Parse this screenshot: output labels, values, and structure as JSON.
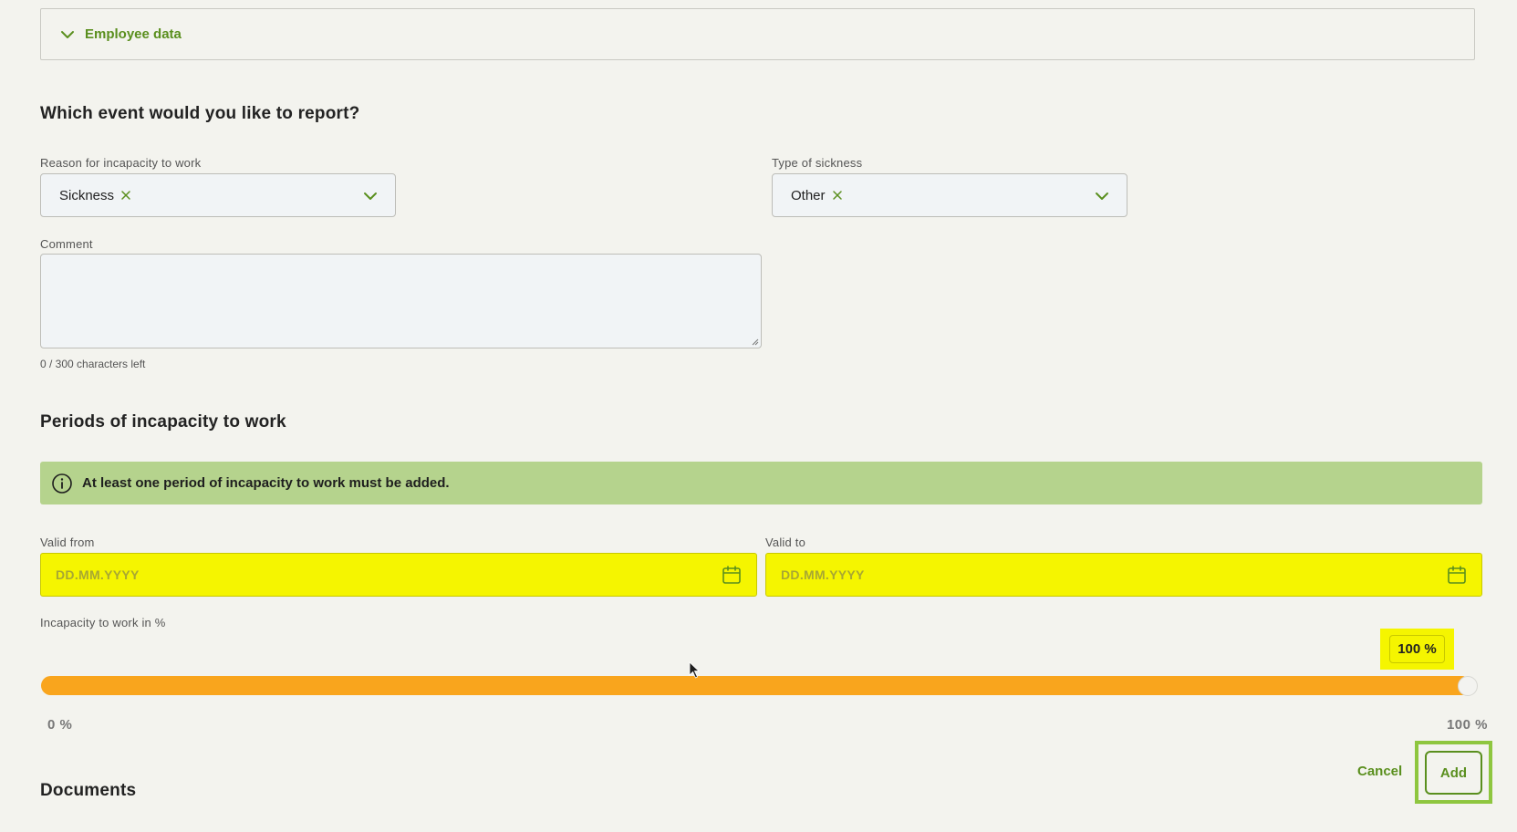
{
  "accordion": {
    "label": "Employee data"
  },
  "event_section": {
    "title": "Which event would you like to report?"
  },
  "reason_field": {
    "label": "Reason for incapacity to work",
    "value": "Sickness"
  },
  "sickness_type_field": {
    "label": "Type of sickness",
    "value": "Other"
  },
  "comment_field": {
    "label": "Comment",
    "value": "",
    "char_count": "0 / 300 characters left"
  },
  "periods_section": {
    "title": "Periods of incapacity to work",
    "info_message": "At least one period of incapacity to work must be added."
  },
  "valid_from": {
    "label": "Valid from",
    "placeholder": "DD.MM.YYYY"
  },
  "valid_to": {
    "label": "Valid to",
    "placeholder": "DD.MM.YYYY"
  },
  "incapacity_slider": {
    "label": "Incapacity to work in %",
    "value_label": "100 %",
    "value_percent": 100,
    "min_label": "0 %",
    "max_label": "100 %"
  },
  "actions": {
    "cancel_label": "Cancel",
    "add_label": "Add"
  },
  "documents_section": {
    "title": "Documents"
  },
  "colors": {
    "accent": "#5a8f1e",
    "info_bg": "#b5d38d",
    "highlight": "#f5f500",
    "slider_fill": "#f9a51d",
    "focus_outline": "#8ec63f"
  },
  "icons": [
    "chevron-down-icon",
    "close-icon",
    "info-icon",
    "calendar-icon",
    "mouse-cursor-icon"
  ]
}
